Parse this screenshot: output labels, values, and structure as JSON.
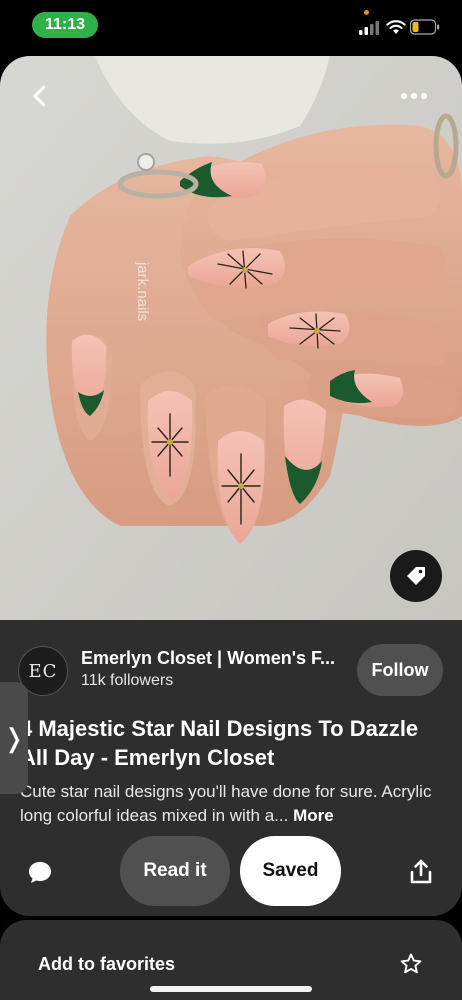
{
  "status_bar": {
    "time": "11:13"
  },
  "pin": {
    "watermark": "jark.nails",
    "creator": {
      "initials": "EC",
      "name": "Emerlyn Closet | Women's F...",
      "followers": "11k followers",
      "follow_label": "Follow"
    },
    "title": "4 Majestic Star Nail Designs To Dazzle All Day - Emerlyn Closet",
    "description": "Cute star nail designs you'll have done for sure. Acrylic long colorful ideas mixed in with a...",
    "more_label": "More"
  },
  "actions": {
    "read_label": "Read it",
    "saved_label": "Saved"
  },
  "sheet": {
    "favorites_label": "Add to favorites"
  },
  "icons": {
    "back": "chevron-left-icon",
    "more": "more-horizontal-icon",
    "tag": "tag-icon",
    "comment": "comment-icon",
    "share": "share-icon",
    "star": "star-outline-icon",
    "side": "chevron-right-icon"
  },
  "colors": {
    "time_pill": "#2fb14a",
    "card": "#2e2e2e",
    "button_gray": "#505050",
    "saved_bg": "#ffffff",
    "nail_green": "#1c5a2e"
  }
}
